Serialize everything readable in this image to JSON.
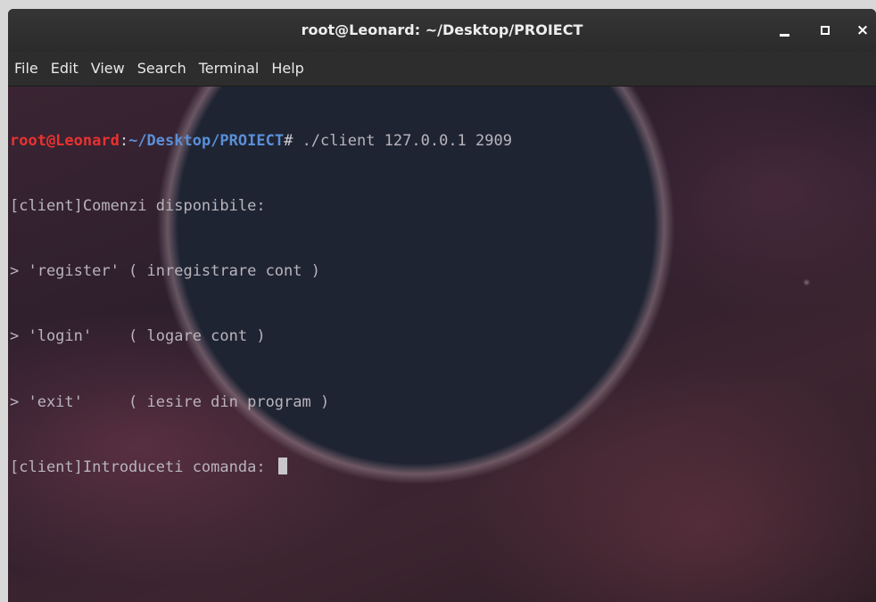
{
  "window": {
    "title": "root@Leonard: ~/Desktop/PROIECT",
    "buttons": {
      "minimize": "minimize-icon",
      "maximize": "maximize-icon",
      "close": "×"
    }
  },
  "menu": {
    "items": [
      "File",
      "Edit",
      "View",
      "Search",
      "Terminal",
      "Help"
    ]
  },
  "terminal": {
    "prompt": {
      "user_host": "root@Leonard",
      "colon": ":",
      "path": "~/Desktop/PROIECT",
      "symbol": "#",
      "command": " ./client 127.0.0.1 2909"
    },
    "lines": [
      "[client]Comenzi disponibile:",
      "> 'register' ( inregistrare cont )",
      "> 'login'    ( logare cont )",
      "> 'exit'     ( iesire din program )"
    ],
    "input_prompt": "[client]Introduceti comanda: "
  },
  "colors": {
    "prompt_user": "#e8322f",
    "prompt_path": "#5a8fd8",
    "text": "#b9b4bc"
  }
}
